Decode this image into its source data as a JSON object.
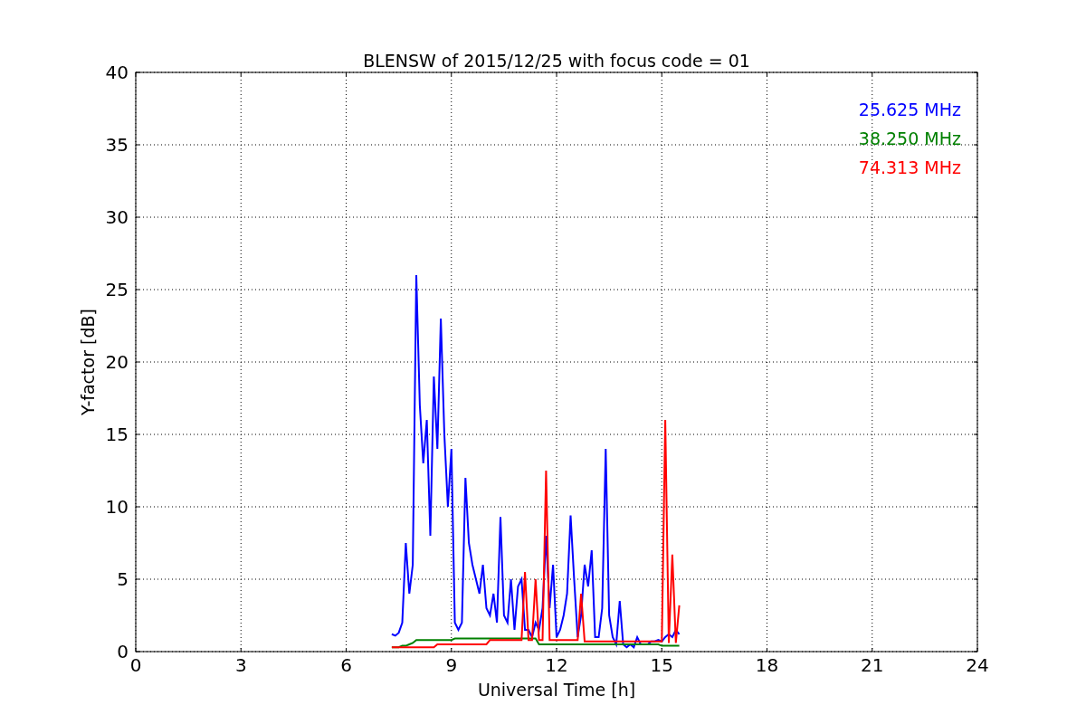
{
  "chart_data": {
    "type": "line",
    "title": "BLENSW of 2015/12/25 with focus code = 01",
    "xlabel": "Universal Time [h]",
    "ylabel": "Y-factor [dB]",
    "grid": true,
    "xlim": [
      0,
      24
    ],
    "ylim": [
      0,
      40
    ],
    "xticks": [
      0,
      3,
      6,
      9,
      12,
      15,
      18,
      21,
      24
    ],
    "yticks": [
      0,
      5,
      10,
      15,
      20,
      25,
      30,
      35,
      40
    ],
    "x": [
      7.3,
      7.4,
      7.5,
      7.6,
      7.7,
      7.8,
      7.9,
      8.0,
      8.1,
      8.2,
      8.3,
      8.4,
      8.5,
      8.6,
      8.7,
      8.8,
      8.9,
      9.0,
      9.1,
      9.2,
      9.3,
      9.4,
      9.5,
      9.6,
      9.7,
      9.8,
      9.9,
      10.0,
      10.1,
      10.2,
      10.3,
      10.4,
      10.5,
      10.6,
      10.7,
      10.8,
      10.9,
      11.0,
      11.1,
      11.2,
      11.3,
      11.4,
      11.5,
      11.6,
      11.7,
      11.8,
      11.9,
      12.0,
      12.1,
      12.2,
      12.3,
      12.4,
      12.5,
      12.6,
      12.7,
      12.8,
      12.9,
      13.0,
      13.1,
      13.2,
      13.3,
      13.4,
      13.5,
      13.6,
      13.7,
      13.8,
      13.9,
      14.0,
      14.1,
      14.2,
      14.3,
      14.4,
      14.5,
      14.6,
      14.7,
      14.8,
      14.9,
      15.0,
      15.1,
      15.2,
      15.3,
      15.4,
      15.5
    ],
    "series": [
      {
        "name": "25.625 MHz",
        "color": "#0000ff",
        "values": [
          1.2,
          1.1,
          1.3,
          2,
          7.5,
          4,
          6,
          26,
          17,
          13,
          16,
          8,
          19,
          14,
          23,
          15,
          10,
          14,
          2,
          1.5,
          2,
          12,
          7.5,
          6,
          5,
          4,
          6,
          3,
          2.5,
          4,
          2,
          9.3,
          2.5,
          2,
          5,
          1.5,
          4.5,
          5,
          1.5,
          1.5,
          1,
          2,
          1.5,
          3,
          8,
          3,
          6,
          1,
          1.5,
          2.5,
          4,
          9.4,
          5,
          1,
          2.5,
          6,
          4.5,
          7,
          1,
          1,
          3,
          14,
          2.5,
          1,
          0.5,
          3.5,
          0.5,
          0.3,
          0.5,
          0.3,
          1,
          0.5,
          0.5,
          0.5,
          0.7,
          0.7,
          0.8,
          0.7,
          1,
          1.2,
          1,
          1.5,
          1.2
        ]
      },
      {
        "name": "38.250 MHz",
        "color": "#008000",
        "values": [
          0.3,
          0.3,
          0.3,
          0.4,
          0.4,
          0.5,
          0.6,
          0.8,
          0.8,
          0.8,
          0.8,
          0.8,
          0.8,
          0.8,
          0.8,
          0.8,
          0.8,
          0.8,
          0.9,
          0.9,
          0.9,
          0.9,
          0.9,
          0.9,
          0.9,
          0.9,
          0.9,
          0.9,
          0.9,
          0.9,
          0.9,
          0.9,
          0.9,
          0.9,
          0.9,
          0.9,
          0.9,
          0.9,
          0.9,
          0.9,
          0.9,
          0.9,
          0.5,
          0.5,
          0.5,
          0.5,
          0.5,
          0.5,
          0.5,
          0.5,
          0.5,
          0.5,
          0.5,
          0.5,
          0.5,
          0.5,
          0.5,
          0.5,
          0.5,
          0.5,
          0.5,
          0.5,
          0.5,
          0.5,
          0.5,
          0.5,
          0.5,
          0.5,
          0.5,
          0.5,
          0.5,
          0.5,
          0.5,
          0.5,
          0.5,
          0.5,
          0.5,
          0.4,
          0.4,
          0.4,
          0.4,
          0.4,
          0.4
        ]
      },
      {
        "name": "74.313 MHz",
        "color": "#ff0000",
        "values": [
          0.3,
          0.3,
          0.3,
          0.3,
          0.3,
          0.3,
          0.3,
          0.3,
          0.3,
          0.3,
          0.3,
          0.3,
          0.3,
          0.5,
          0.5,
          0.5,
          0.5,
          0.5,
          0.5,
          0.5,
          0.5,
          0.5,
          0.5,
          0.5,
          0.5,
          0.5,
          0.5,
          0.5,
          0.8,
          0.8,
          0.8,
          0.8,
          0.8,
          0.8,
          0.8,
          0.8,
          0.8,
          0.8,
          5.5,
          0.8,
          0.8,
          5,
          0.8,
          0.8,
          12.5,
          0.8,
          0.8,
          0.8,
          0.8,
          0.8,
          0.8,
          0.8,
          0.8,
          0.8,
          4,
          0.7,
          0.7,
          0.7,
          0.7,
          0.7,
          0.7,
          0.7,
          0.7,
          0.7,
          0.7,
          0.7,
          0.7,
          0.7,
          0.7,
          0.7,
          0.7,
          0.7,
          0.7,
          0.7,
          0.7,
          0.7,
          0.7,
          0.7,
          16,
          0.6,
          6.7,
          0.6,
          3.2
        ]
      }
    ]
  }
}
